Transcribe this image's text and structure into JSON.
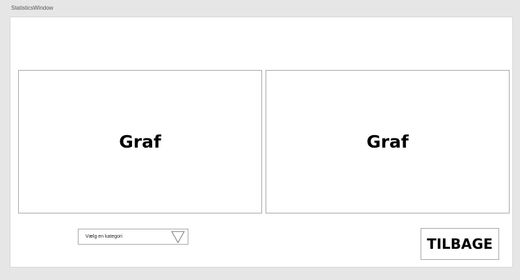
{
  "window": {
    "title": "StatisticsWindow"
  },
  "graphs": [
    {
      "label": "Graf"
    },
    {
      "label": "Graf"
    }
  ],
  "category_select": {
    "value": "Vælg en kategori",
    "icon": "triangle-down-icon"
  },
  "back_button": {
    "label": "TILBAGE"
  },
  "colors": {
    "window_bg": "#e6e6e6",
    "canvas_bg": "#ffffff",
    "border": "#a8a8a8"
  }
}
